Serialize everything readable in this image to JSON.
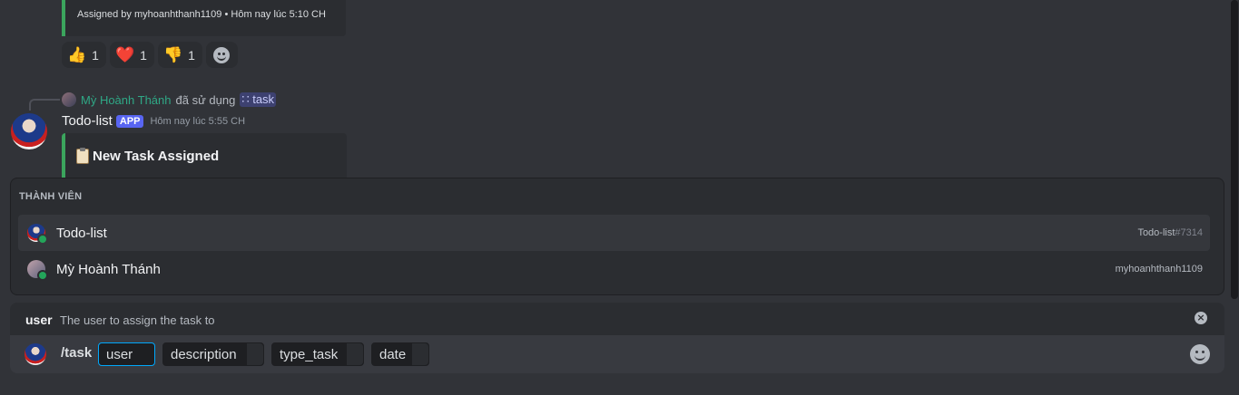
{
  "messages": {
    "prev_embed_footer": "Assigned by myhoanhthanh1109 • Hôm nay lúc 5:10 CH",
    "reactions": [
      {
        "emoji": "👍",
        "count": "1",
        "icon": "thumbs-up-icon"
      },
      {
        "emoji": "❤️",
        "count": "1",
        "icon": "heart-icon"
      },
      {
        "emoji": "👎",
        "count": "1",
        "icon": "thumbs-down-icon"
      }
    ],
    "reply": {
      "user": "Mỳ Hoành Thánh",
      "action": "đã sử dụng",
      "command": "task"
    },
    "message": {
      "author": "Todo-list",
      "badge": "APP",
      "timestamp": "Hôm nay lúc 5:55 CH",
      "embed_title": "New Task Assigned",
      "embed_color": "#3ba55d"
    }
  },
  "autocomplete": {
    "header": "THÀNH VIÊN",
    "members": [
      {
        "name": "Todo-list",
        "tag": "Todo-list",
        "discriminator": "#7314",
        "status": "online"
      },
      {
        "name": "Mỳ Hoành Thánh",
        "tag": "myhoanhthanh1109",
        "discriminator": "",
        "status": "online"
      }
    ]
  },
  "option_hint": {
    "name": "user",
    "description": "The user to assign the task to"
  },
  "input": {
    "command": "/task",
    "options": [
      "user",
      "description",
      "type_task",
      "date"
    ]
  },
  "colors": {
    "background": "#313338",
    "accent": "#5865f2",
    "online": "#23a55a",
    "focus": "#00a8fc"
  }
}
